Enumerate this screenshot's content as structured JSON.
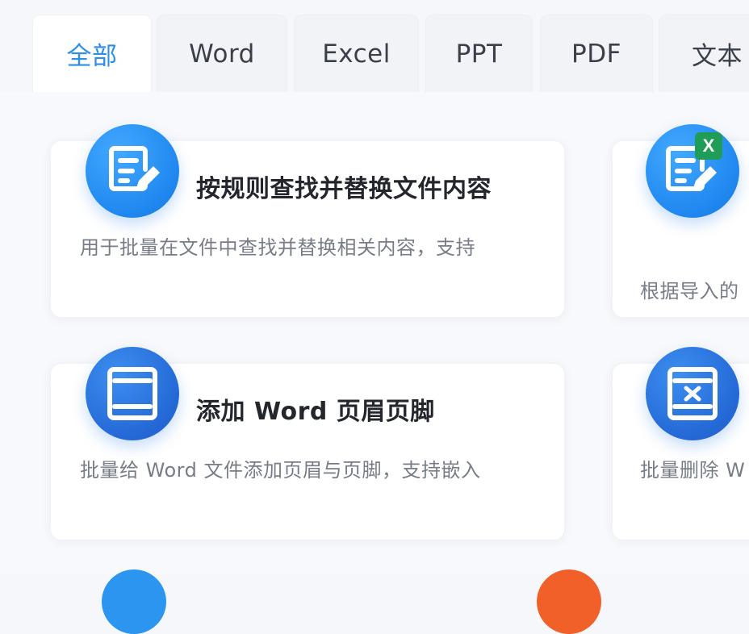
{
  "tabs": [
    {
      "label": "全部",
      "active": true
    },
    {
      "label": "Word",
      "active": false
    },
    {
      "label": "Excel",
      "active": false
    },
    {
      "label": "PPT",
      "active": false
    },
    {
      "label": "PDF",
      "active": false
    },
    {
      "label": "文本",
      "active": false
    }
  ],
  "cards": [
    {
      "title": "按规则查找并替换文件内容",
      "desc": "用于批量在文件中查找并替换相关内容，支持",
      "icon": "document-edit-icon"
    },
    {
      "title": "",
      "desc": "根据导入的",
      "icon": "excel-document-edit-icon",
      "badge": "X"
    },
    {
      "title": "添加 Word 页眉页脚",
      "desc": "批量给 Word 文件添加页眉与页脚，支持嵌入",
      "icon": "header-footer-icon"
    },
    {
      "title": "",
      "desc": "批量删除 W",
      "icon": "delete-header-footer-icon"
    }
  ],
  "colors": {
    "accent": "#2c8ee8",
    "icon_blue": "#1f87ef",
    "excel_green": "#1f9d57",
    "peek_orange": "#f2602a"
  }
}
